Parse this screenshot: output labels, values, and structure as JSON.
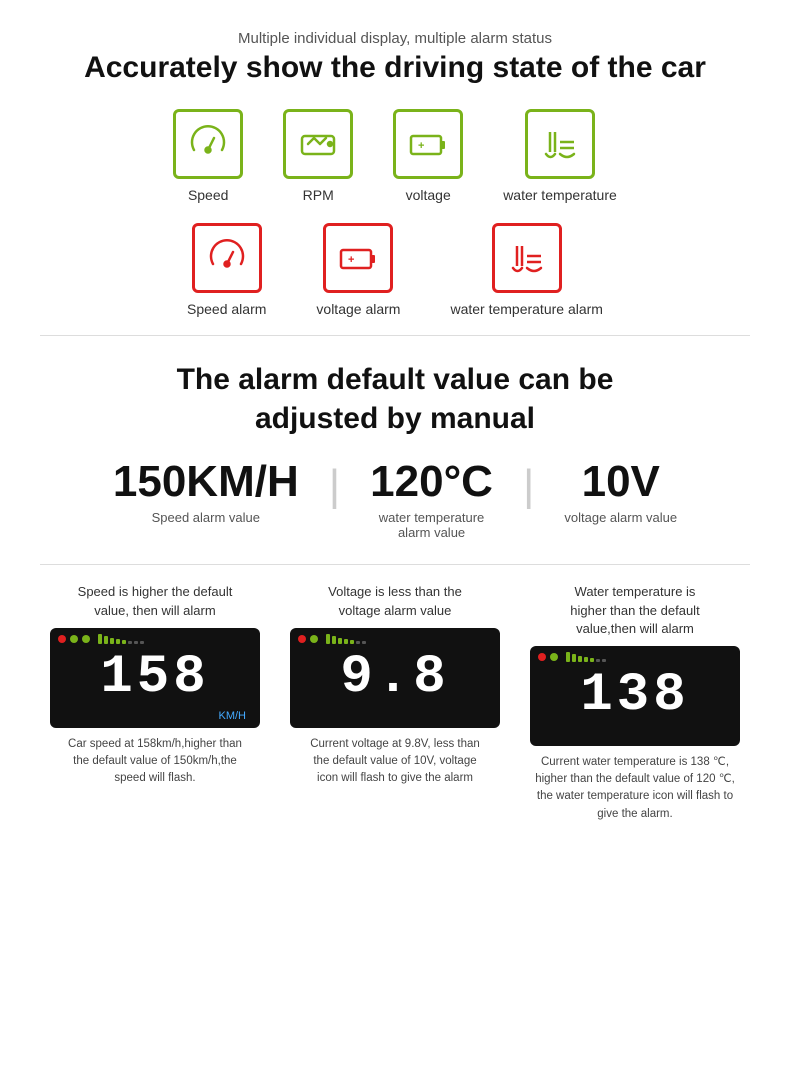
{
  "section1": {
    "subtitle": "Multiple individual display, multiple alarm status",
    "title": "Accurately show the driving state of the car"
  },
  "green_icons": [
    {
      "id": "speed",
      "label": "Speed"
    },
    {
      "id": "rpm",
      "label": "RPM"
    },
    {
      "id": "voltage",
      "label": "voltage"
    },
    {
      "id": "water_temp",
      "label": "water temperature"
    }
  ],
  "red_icons": [
    {
      "id": "speed_alarm",
      "label": "Speed alarm"
    },
    {
      "id": "voltage_alarm",
      "label": "voltage alarm"
    },
    {
      "id": "water_alarm",
      "label": "water temperature alarm"
    }
  ],
  "section2": {
    "title": "The alarm default value can be\nadjusted by manual"
  },
  "alarm_values": [
    {
      "number": "150KM/H",
      "label": "Speed alarm value"
    },
    {
      "number": "120°C",
      "label": "water temperature\nalarm value"
    },
    {
      "number": "10V",
      "label": "voltage alarm value"
    }
  ],
  "panels": [
    {
      "title": "Speed is higher the default\nvalue, then will alarm",
      "display_number": "158",
      "unit": "KM/H",
      "desc": "Car speed at 158km/h,higher than\nthe default value of 150km/h,the\nspeed will flash."
    },
    {
      "title": "Voltage is less than the\nvoltage alarm value",
      "display_number": "9.8",
      "unit": "",
      "desc": "Current voltage at 9.8V, less than\nthe default value of 10V, voltage\nicon will flash to give the alarm"
    },
    {
      "title": "Water temperature is\nhigher than the default\nvalue,then will alarm",
      "display_number": "138",
      "unit": "",
      "desc": "Current water temperature is 138 ℃,\nhigher than the default value of 120 ℃,\nthe water temperature icon will flash to\ngive the alarm."
    }
  ]
}
